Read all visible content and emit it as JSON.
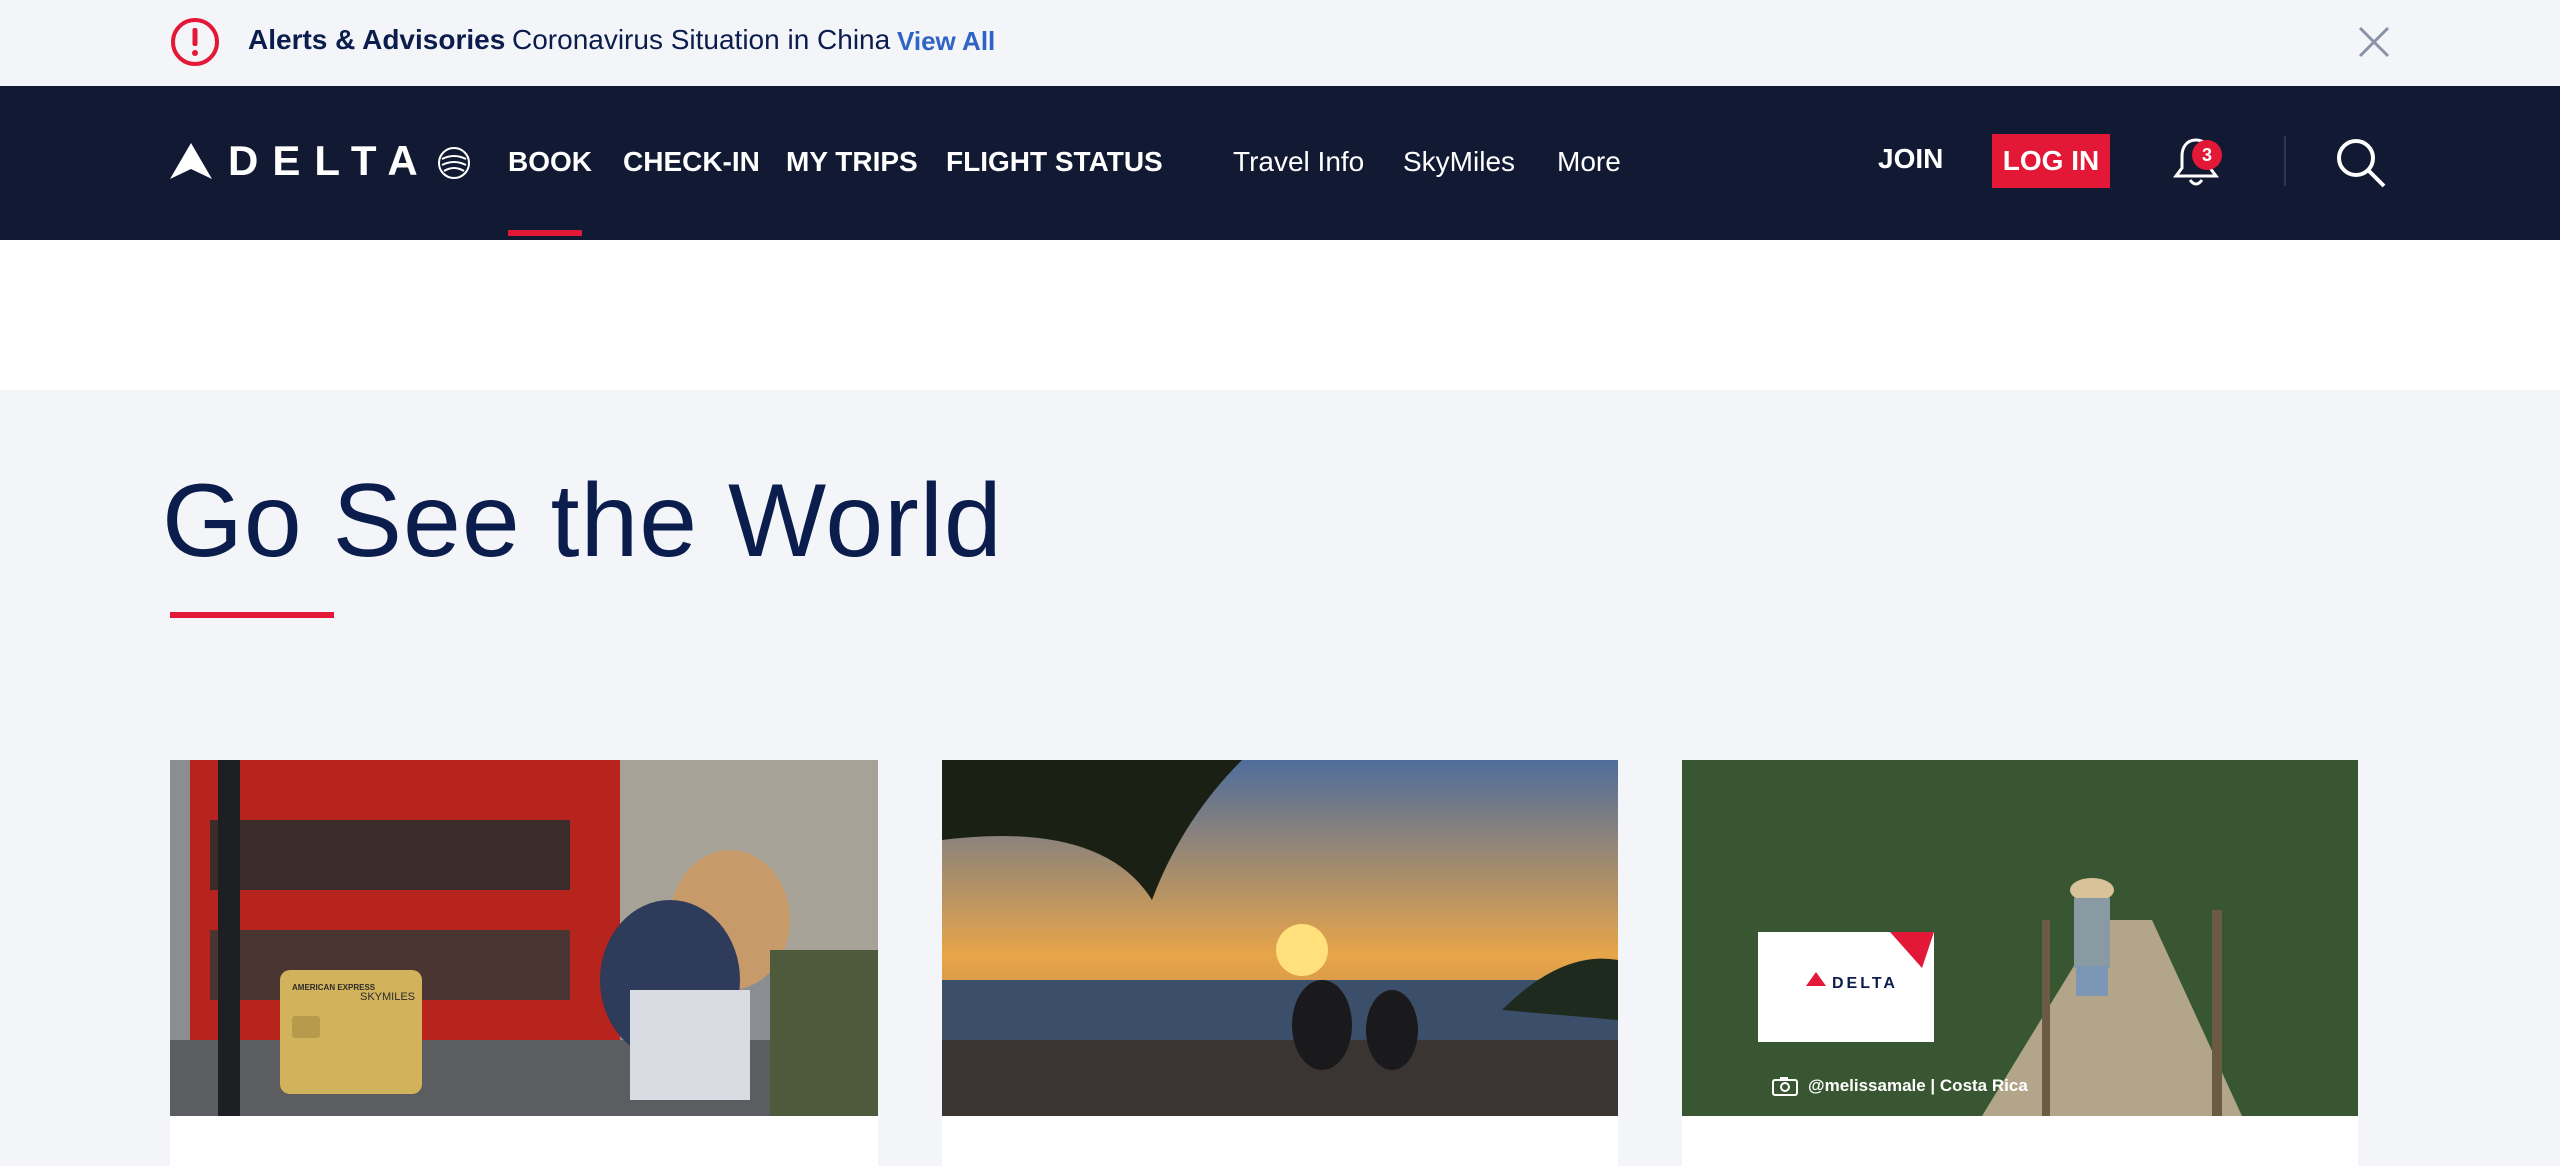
{
  "alerts": {
    "title": "Alerts & Advisories",
    "message": "Coronavirus Situation in China",
    "link": "View All"
  },
  "nav": {
    "logo_text": "DELTA",
    "primary": [
      "BOOK",
      "CHECK-IN",
      "MY TRIPS",
      "FLIGHT STATUS"
    ],
    "secondary": [
      "Travel Info",
      "SkyMiles",
      "More"
    ],
    "join": "JOIN",
    "login": "LOG IN",
    "notification_count": "3"
  },
  "hero": {
    "title": "Go See the World"
  },
  "cards": [
    {
      "name": "london-card",
      "card_brand": "AMERICAN EXPRESS",
      "card_label": "SKYMILES"
    },
    {
      "name": "beach-sunset-card"
    },
    {
      "name": "costa-rica-card",
      "brand": "DELTA",
      "credit": "@melissamale | Costa Rica"
    }
  ],
  "colors": {
    "navy": "#111a32",
    "accent_red": "#e31837",
    "headline_blue": "#0b1d4d",
    "link_blue": "#2f63c5"
  }
}
